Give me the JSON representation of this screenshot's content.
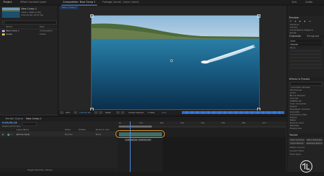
{
  "project_panel": {
    "tab_project": "Project",
    "tab_effect_controls": "Effect Controls Layer",
    "thumb_title": "New Comp 1",
    "thumb_meta_1": "1920 x 1080 (1.00)",
    "thumb_meta_2": "0;00;20;00, 29.97 fps",
    "search_placeholder": "",
    "col_name": "Name",
    "col_type": "Type",
    "items": [
      {
        "name": "New Comp 1",
        "type": "Composition",
        "color": "#b8a8e0"
      },
      {
        "name": "Solids",
        "type": "Folder",
        "color": "#e2c65a"
      }
    ]
  },
  "viewer": {
    "tab_composition": "Composition: New Comp 1",
    "tab_footage": "Footage (none)",
    "tab_layer": "Layer (none)",
    "breadcrumb": "New Comp 1",
    "zoom": "50%",
    "resolution": "(Half)",
    "timecode": "0;00;01;28",
    "camera": "Active Camera",
    "views": "1 View",
    "exposure": "+0.0"
  },
  "right_panel": {
    "info_title": "Info",
    "audio_title": "Audio",
    "preview_title": "Preview",
    "preview_items": [
      "Shortcut",
      "Include",
      "Cache Before Playback",
      "Range",
      "Play From"
    ],
    "character_title": "Character",
    "paragraph_title": "Paragraph",
    "font": "Arial",
    "font_style": "Regular",
    "font_size": "36 px",
    "effects_title": "Effects & Presets",
    "effects_search": "",
    "effects": [
      "* Animation Presets",
      "3D Channel",
      "Audio",
      "Blur & Sharpen",
      "Channel",
      "CINEMA 4D",
      "Color Correction",
      "Distort",
      "Expression Controls",
      "Generate",
      "Immersive Video",
      "Keying",
      "Matte",
      "Noise & Grain",
      "Obsolete",
      "Perspective"
    ],
    "tracker_title": "Tracker",
    "tracker_buttons": [
      "Track Camera",
      "Warp Stabilizer",
      "Track Motion",
      "Stabilize Motion"
    ],
    "motion_source_label": "Motion Source:",
    "current_track_label": "Current Track:",
    "track_type_label": "Track Type:"
  },
  "timeline": {
    "tab_render": "Render Queue",
    "tab_comp": "New Comp 1",
    "timecode": "0;00;00;16",
    "timecode_sub": "00016 (29.97 fps)",
    "col_layer_name": "Layer Name",
    "col_mode": "Mode",
    "col_trkmat": "TrkMat",
    "col_parent": "Parent & Link",
    "layers": [
      {
        "num": "1",
        "name": "[Drone.mp4]",
        "mode": "Normal",
        "parent": "None"
      }
    ],
    "work_area_readout": "0;00;00;16 - 0;00;01;28",
    "ruler_ticks": [
      "0s",
      "01s",
      "02s",
      "03s",
      "04s",
      "05s",
      "06s",
      "07s"
    ],
    "footer_toggle": "Toggle Switches / Modes"
  },
  "colors": {
    "accent_blue": "#2d6fd2",
    "work_area_orange": "#e8962c",
    "label_purple": "#b8a8e0",
    "folder_yellow": "#e2c65a",
    "layer_teal": "#4f8a7a"
  }
}
